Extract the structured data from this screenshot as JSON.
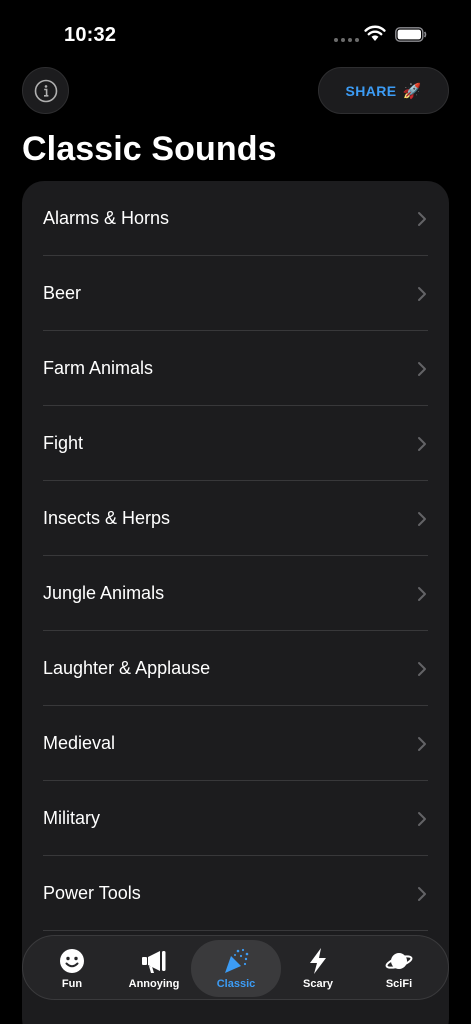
{
  "status": {
    "time": "10:32"
  },
  "header": {
    "share_label": "SHARE",
    "share_emoji": "🚀"
  },
  "page": {
    "title": "Classic Sounds"
  },
  "categories": [
    "Alarms & Horns",
    "Beer",
    "Farm Animals",
    "Fight",
    "Insects & Herps",
    "Jungle Animals",
    "Laughter & Applause",
    "Medieval",
    "Military",
    "Power Tools"
  ],
  "tabs": [
    {
      "label": "Fun",
      "icon": "smiley-icon",
      "active": false
    },
    {
      "label": "Annoying",
      "icon": "megaphone-icon",
      "active": false
    },
    {
      "label": "Classic",
      "icon": "party-popper-icon",
      "active": true
    },
    {
      "label": "Scary",
      "icon": "lightning-icon",
      "active": false
    },
    {
      "label": "SciFi",
      "icon": "planet-icon",
      "active": false
    }
  ],
  "colors": {
    "accent": "#3c9cf5",
    "background": "#000000",
    "card": "#1c1c1e"
  }
}
